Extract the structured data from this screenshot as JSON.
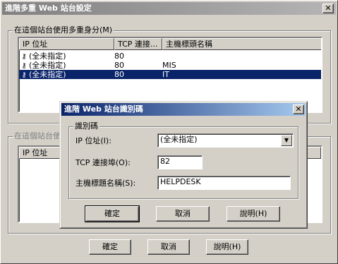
{
  "main_window": {
    "title": "進階多重 Web 站台設定",
    "close_glyph": "✕",
    "group1_label": "在這個站台使用多重身分(M)",
    "list_columns": [
      "IP 位址",
      "TCP 連接...",
      "主機標頭名稱"
    ],
    "list_rows": [
      {
        "ip": "(全未指定)",
        "port": "80",
        "host": ""
      },
      {
        "ip": "(全未指定)",
        "port": "80",
        "host": "MIS"
      },
      {
        "ip": "(全未指定)",
        "port": "80",
        "host": "IT"
      }
    ],
    "group2_label": "在這個站台使",
    "list2_column": "IP 位址",
    "ok_label": "確定",
    "cancel_label": "取消",
    "help_label": "說明(H)"
  },
  "dialog": {
    "title": "進階 Web 站台識別碼",
    "close_glyph": "✕",
    "group_label": "識別碼",
    "ip_label": "IP 位址(I):",
    "ip_value": "(全未指定)",
    "port_label": "TCP 連接埠(O):",
    "port_value": "82",
    "host_label": "主機標題名稱(S):",
    "host_value": "HELPDESK",
    "ok_label": "確定",
    "cancel_label": "取消",
    "help_label": "說明(H)"
  },
  "colors": {
    "face": "#d4d0c8",
    "selection": "#0a246a",
    "active_title": "#0a246a",
    "inactive_title": "#808080"
  },
  "icons": {
    "row_icon": "key-icon",
    "dropdown_icon": "chevron-down-icon"
  }
}
